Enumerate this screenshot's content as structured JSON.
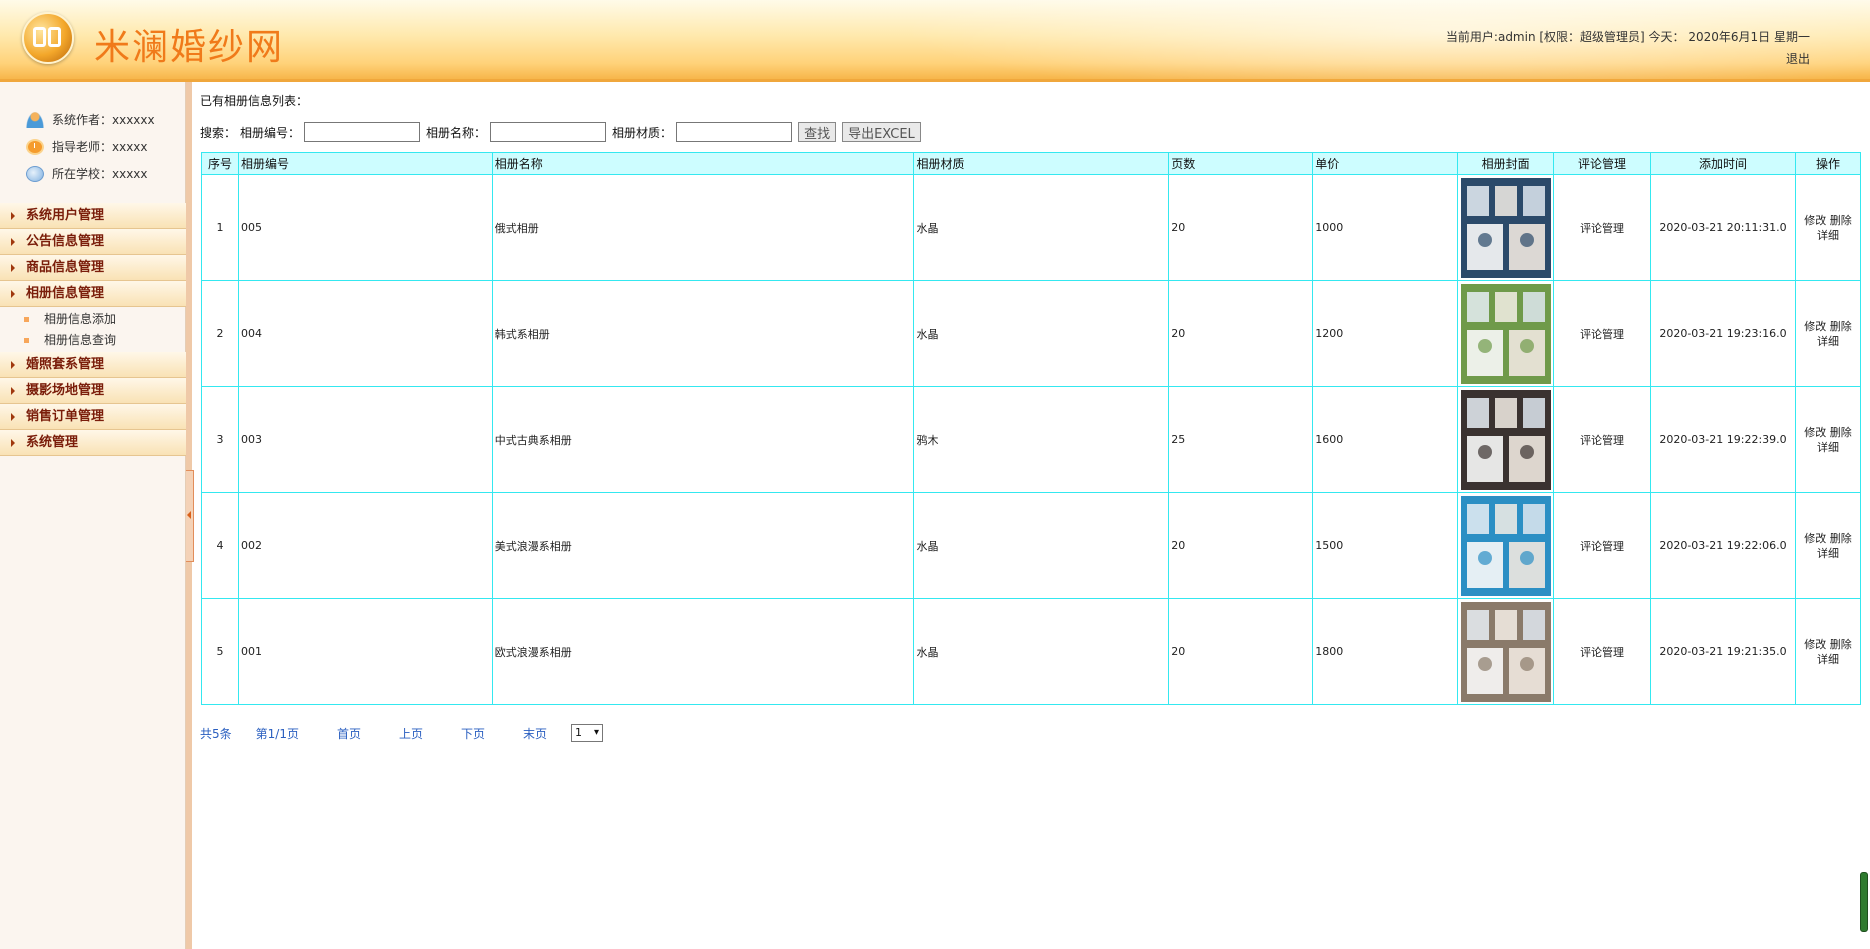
{
  "header": {
    "site_title": "米澜婚纱网",
    "user_info": "当前用户:admin [权限：超级管理员] 今天： 2020年6月1日 星期一",
    "logout": "退出"
  },
  "sidebar": {
    "info": [
      {
        "label": "系统作者：xxxxxx",
        "icon": "person-icon"
      },
      {
        "label": "指导老师：xxxxx",
        "icon": "clock-icon"
      },
      {
        "label": "所在学校：xxxxx",
        "icon": "globe-icon"
      }
    ],
    "menu": [
      {
        "label": "系统用户管理"
      },
      {
        "label": "公告信息管理"
      },
      {
        "label": "商品信息管理"
      },
      {
        "label": "相册信息管理",
        "expanded": true,
        "children": [
          "相册信息添加",
          "相册信息查询"
        ]
      },
      {
        "label": "婚照套系管理"
      },
      {
        "label": "摄影场地管理"
      },
      {
        "label": "销售订单管理"
      },
      {
        "label": "系统管理"
      }
    ]
  },
  "main": {
    "list_title": "已有相册信息列表：",
    "search": {
      "label": "搜索：",
      "field1_label": "相册编号：",
      "field1_value": "",
      "field2_label": "相册名称：",
      "field2_value": "",
      "field3_label": "相册材质：",
      "field3_value": "",
      "search_button": "查找",
      "export_button": "导出EXCEL"
    },
    "table": {
      "headers": [
        "序号",
        "相册编号",
        "相册名称",
        "相册材质",
        "页数",
        "单价",
        "相册封面",
        "评论管理",
        "添加时间",
        "操作"
      ],
      "rows": [
        {
          "index": "1",
          "code": "005",
          "name": "俄式相册",
          "material": "水晶",
          "pages": "20",
          "price": "1000",
          "comment": "评论管理",
          "time": "2020-03-21 20:11:31.0",
          "edit": "修改",
          "delete": "删除",
          "detail": "详细",
          "cover_theme": "#2b4a6a"
        },
        {
          "index": "2",
          "code": "004",
          "name": "韩式系相册",
          "material": "水晶",
          "pages": "20",
          "price": "1200",
          "comment": "评论管理",
          "time": "2020-03-21 19:23:16.0",
          "edit": "修改",
          "delete": "删除",
          "detail": "详细",
          "cover_theme": "#6f9a4a"
        },
        {
          "index": "3",
          "code": "003",
          "name": "中式古典系相册",
          "material": "鸦木",
          "pages": "25",
          "price": "1600",
          "comment": "评论管理",
          "time": "2020-03-21 19:22:39.0",
          "edit": "修改",
          "delete": "删除",
          "detail": "详细",
          "cover_theme": "#3a3230"
        },
        {
          "index": "4",
          "code": "002",
          "name": "美式浪漫系相册",
          "material": "水晶",
          "pages": "20",
          "price": "1500",
          "comment": "评论管理",
          "time": "2020-03-21 19:22:06.0",
          "edit": "修改",
          "delete": "删除",
          "detail": "详细",
          "cover_theme": "#2b8fc4"
        },
        {
          "index": "5",
          "code": "001",
          "name": "欧式浪漫系相册",
          "material": "水晶",
          "pages": "20",
          "price": "1800",
          "comment": "评论管理",
          "time": "2020-03-21 19:21:35.0",
          "edit": "修改",
          "delete": "删除",
          "detail": "详细",
          "cover_theme": "#8a7a6a"
        }
      ]
    },
    "pager": {
      "total": "共5条",
      "page": "第1/1页",
      "first": "首页",
      "prev": "上页",
      "next": "下页",
      "last": "末页",
      "select_value": "1"
    }
  }
}
